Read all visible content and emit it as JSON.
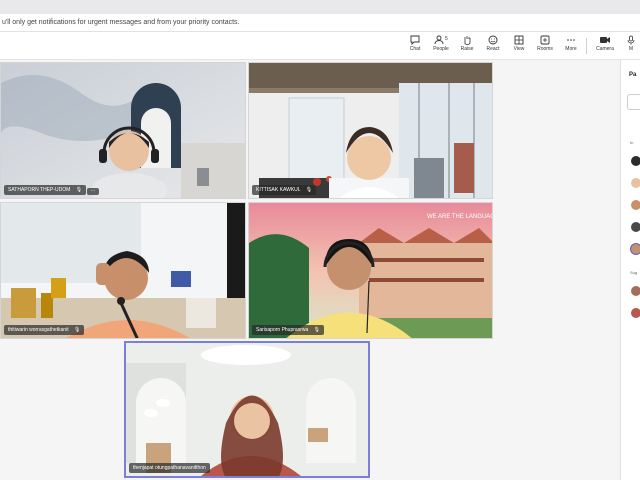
{
  "notification": {
    "text": "u'll only get notifications for urgent messages and from your priority contacts."
  },
  "toolbar": {
    "chat": "Chat",
    "people": "People",
    "people_count": "5",
    "raise": "Raise",
    "react": "React",
    "view": "View",
    "rooms": "Rooms",
    "more": "More",
    "camera": "Camera",
    "mic_cut": "M"
  },
  "participants": [
    {
      "name": "SATHAPORN THEP-UDOM"
    },
    {
      "name": "KITTISAK KAWKUL"
    },
    {
      "name": "thitiwarin worrasgathetkanit"
    },
    {
      "name": "Sarisaporn Phuprasrwa"
    },
    {
      "name": "thenjapat otungpathanavanitthon"
    }
  ],
  "side_panel": {
    "title": "Pa",
    "section_in_meeting": "In",
    "section_suggestions": "Sug"
  },
  "colors": {
    "accent": "#5b5fc7",
    "tile_border_active": "#7b7fd8",
    "name_tag_bg": "#2b2b2b"
  }
}
